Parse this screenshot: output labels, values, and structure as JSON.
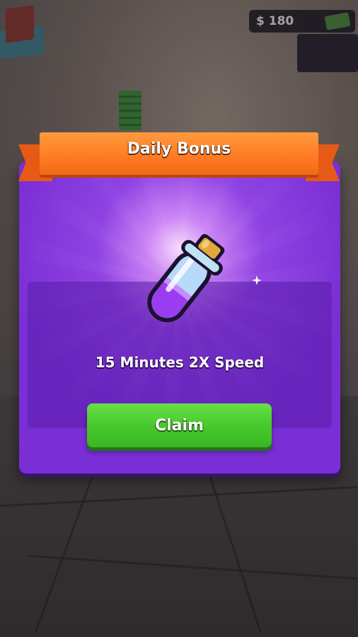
{
  "hud": {
    "money": "$ 180",
    "money_icon": "cash-icon"
  },
  "popup": {
    "title": "Daily Bonus",
    "reward_icon": "speed-potion-icon",
    "reward_label": "15 Minutes 2X Speed",
    "claim_label": "Claim"
  },
  "colors": {
    "panel": "#7a2fd6",
    "ribbon": "#ff7a22",
    "claim_button": "#46c72b"
  }
}
